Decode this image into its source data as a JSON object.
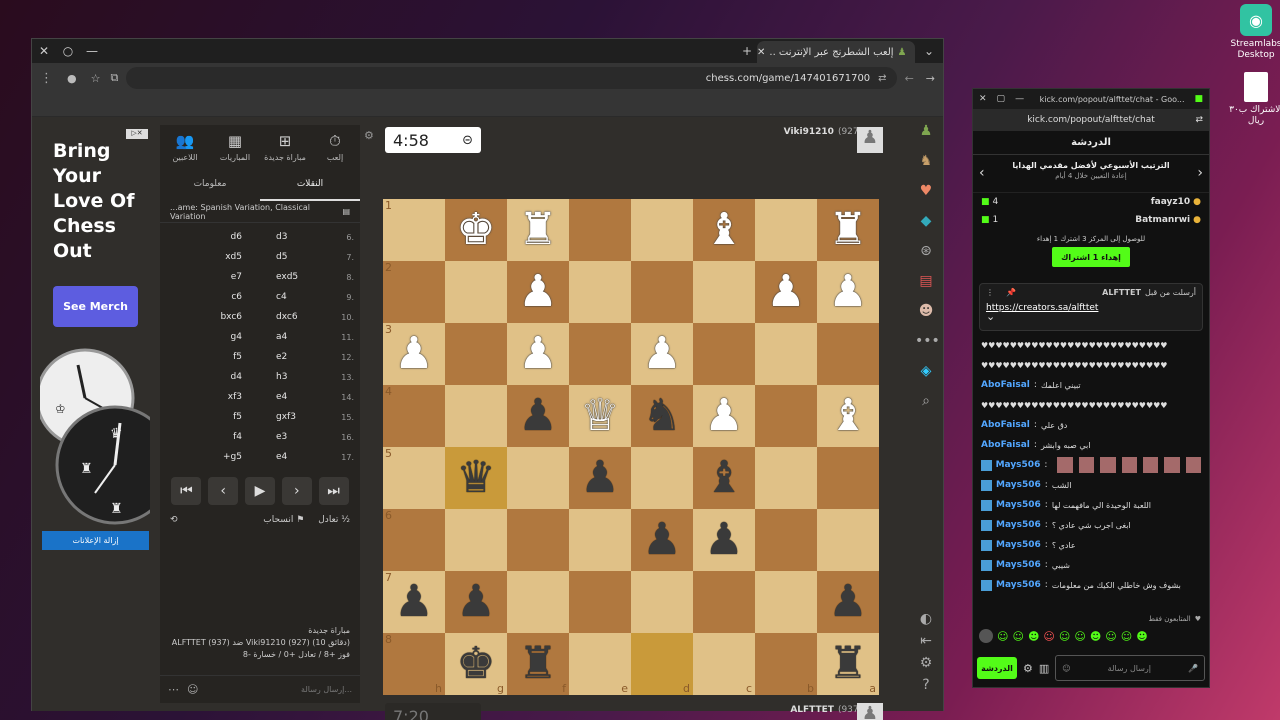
{
  "desktop": {
    "icons": [
      {
        "label": "Streamlabs Desktop"
      },
      {
        "label": "الاشتراك ب٣٠ ريال"
      }
    ]
  },
  "browser": {
    "tab_title": "إلعب الشطرنج عبر الإنترنت ..",
    "url": "chess.com/game/147401671700",
    "ad": {
      "title": "Bring Your Love Of Chess Out",
      "button": "See Merch",
      "remove": "إزالة الإعلانات"
    },
    "nav": {
      "play": "إلعب",
      "new_game": "مباراة جديدة",
      "games": "المباريات",
      "players": "اللاعبين"
    },
    "subtabs": {
      "moves": "النقلات",
      "info": "معلومات"
    },
    "opening": "...ame: Spanish Variation, Classical Variation",
    "moves": [
      {
        "n": "6.",
        "w": "d3",
        "b": "d6"
      },
      {
        "n": "7.",
        "w": "d5",
        "b": "xd5"
      },
      {
        "n": "8.",
        "w": "exd5",
        "b": "e7"
      },
      {
        "n": "9.",
        "w": "c4",
        "b": "c6"
      },
      {
        "n": "10.",
        "w": "dxc6",
        "b": "bxc6"
      },
      {
        "n": "11.",
        "w": "a4",
        "b": "g4"
      },
      {
        "n": "12.",
        "w": "e2",
        "b": "f5"
      },
      {
        "n": "13.",
        "w": "h3",
        "b": "d4"
      },
      {
        "n": "14.",
        "w": "e4",
        "b": "xf3"
      },
      {
        "n": "15.",
        "w": "gxf3",
        "b": "f5"
      },
      {
        "n": "16.",
        "w": "e3",
        "b": "f4"
      },
      {
        "n": "17.",
        "w": "e4",
        "b": "+g5"
      }
    ],
    "draw": "تعادل",
    "resign": "انسحاب",
    "game_info": {
      "line1": "مباراة جديدة",
      "line2": "ALFTTET (937) ضد Viki91210 (927) (10 دقائق)",
      "line3": "فوز +8 / تعادل +0 / خسارة -8"
    },
    "message_placeholder": "إرسال رسالة...",
    "top_player": {
      "name": "Viki91210",
      "rating": "(927)"
    },
    "bottom_player": {
      "name": "ALFTTET",
      "rating": "(937)"
    },
    "top_clock": "4:58",
    "bottom_clock": "7:20"
  },
  "board": {
    "ranks": [
      "1",
      "2",
      "3",
      "4",
      "5",
      "6",
      "7",
      "8"
    ],
    "files": [
      "h",
      "g",
      "f",
      "e",
      "d",
      "c",
      "b",
      "a"
    ],
    "rows": [
      [
        "",
        "♚",
        "♜",
        "",
        "",
        "♝",
        "",
        "♜"
      ],
      [
        "",
        "",
        "♟",
        "",
        "",
        "",
        "♟",
        "♟"
      ],
      [
        "♟",
        "",
        "♟",
        "",
        "♟",
        "",
        "",
        ""
      ],
      [
        "",
        "",
        "*p",
        "♕",
        "*n",
        "♟",
        "",
        "♝"
      ],
      [
        "",
        "*q",
        "",
        "*p",
        "",
        "*b",
        "",
        ""
      ],
      [
        "",
        "",
        "",
        "",
        "*p",
        "*p",
        "",
        ""
      ],
      [
        "*p",
        "*p",
        "",
        "",
        "",
        "",
        "",
        "*p"
      ],
      [
        "",
        "*k",
        "*r",
        "",
        "",
        "",
        "",
        "*r"
      ]
    ]
  },
  "chat": {
    "url": "kick.com/popout/alfttet/chat - Goo...",
    "url2": "kick.com/popout/alfttet/chat",
    "header": "الدردشة",
    "leaderboard_title": "الترتيب الأسبوعي لأفضل مقدمي الهدايا",
    "leaderboard_sub": "إعادة التعيين خلال 4 أيام",
    "top": [
      {
        "name": "faayz10",
        "count": "4"
      },
      {
        "name": "Batmanrwi",
        "count": "1"
      }
    ],
    "gift_text": "للوصول إلى المركز 3 اشترك 1 إهداء",
    "gift_button": "إهداء 1 اشتراك",
    "pinned_by": "أرسلت من قبل",
    "pinned_user": "ALFTTET",
    "pinned_link": "https://creators.sa/alfttet",
    "messages": [
      {
        "user": "",
        "text": "♥♥♥♥♥♥♥♥♥♥♥♥♥♥♥♥♥♥♥♥♥♥♥♥♥♥"
      },
      {
        "user": "",
        "text": "♥♥♥♥♥♥♥♥♥♥♥♥♥♥♥♥♥♥♥♥♥♥♥♥♥♥"
      },
      {
        "user": "AboFaisal",
        "text": "تبيني اعلمك"
      },
      {
        "user": "",
        "text": "♥♥♥♥♥♥♥♥♥♥♥♥♥♥♥♥♥♥♥♥♥♥♥♥♥♥"
      },
      {
        "user": "AboFaisal",
        "text": "دق علي"
      },
      {
        "user": "AboFaisal",
        "text": "ابي صبه وابشر"
      },
      {
        "user": "Mays506",
        "text": ""
      },
      {
        "user": "Mays506",
        "text": "الشب"
      },
      {
        "user": "Mays506",
        "text": "اللعبة الوحيدة الي مافهمت لها"
      },
      {
        "user": "Mays506",
        "text": "ابغى اجرب شي عادي ؟"
      },
      {
        "user": "Mays506",
        "text": "عادي ؟"
      },
      {
        "user": "Mays506",
        "text": "شيبي"
      },
      {
        "user": "Mays506",
        "text": "بشوف وش خاطلي الكيك من معلومات"
      }
    ],
    "followers_only": "المتابعون فقط",
    "input_placeholder": "إرسال رسالة",
    "send": "الدردشة"
  },
  "colors": {
    "kick_green": "#53fc18",
    "board_light": "#e0c187",
    "board_dark": "#b0783f"
  }
}
